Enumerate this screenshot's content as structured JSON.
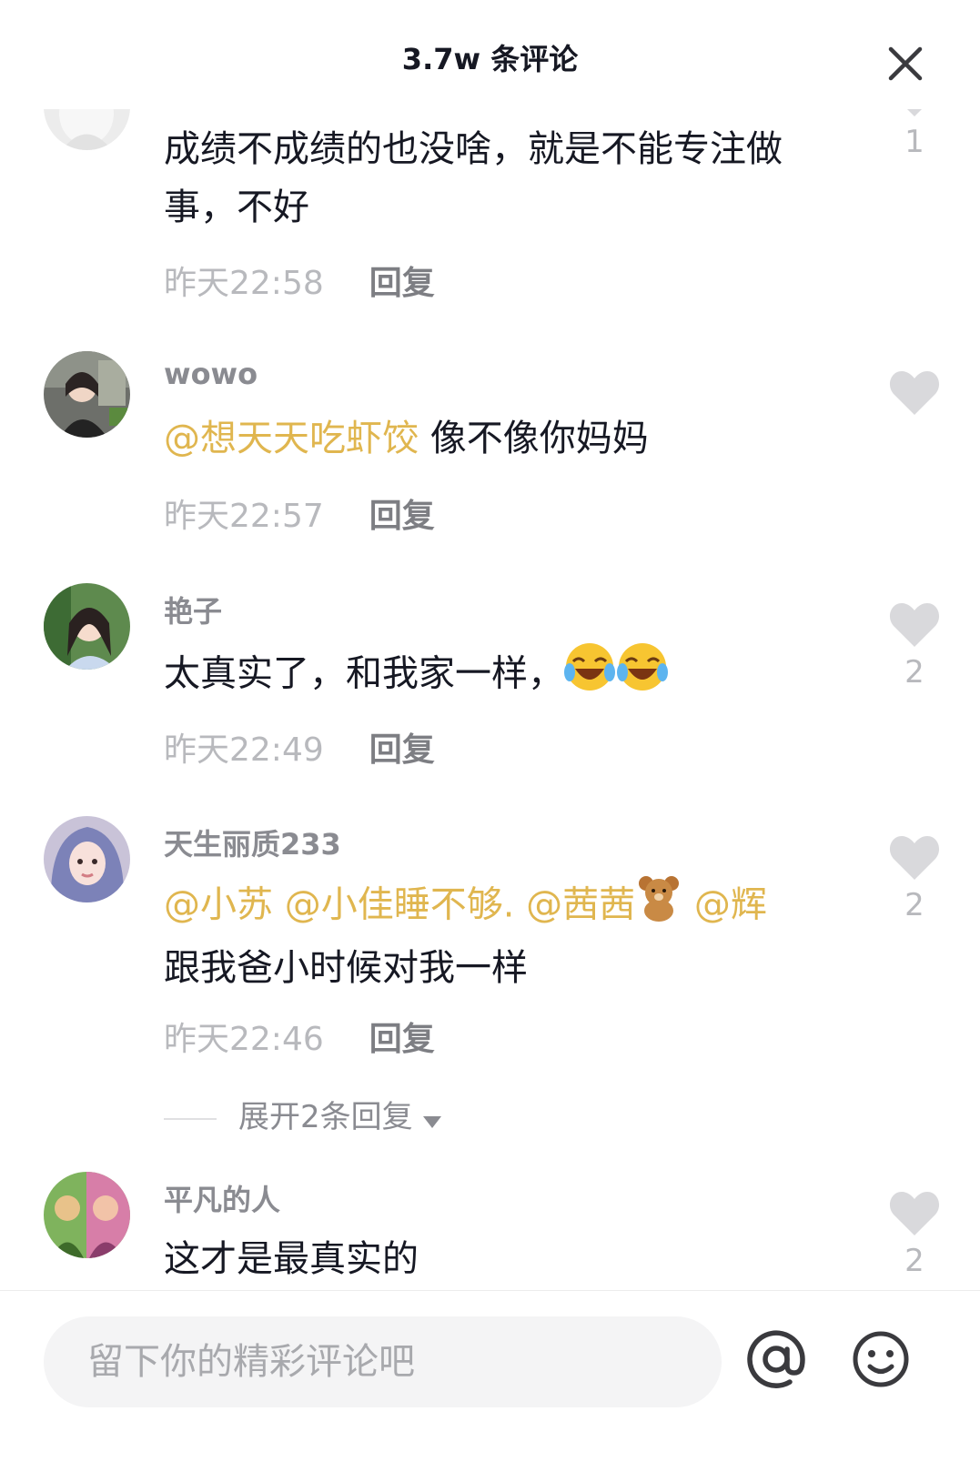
{
  "header": {
    "title": "3.7w 条评论"
  },
  "comments": [
    {
      "username": "",
      "text": "成绩不成绩的也没啥，就是不能专注做事，不好",
      "time": "昨天22:58",
      "reply": "回复",
      "likes": "1"
    },
    {
      "username": "wowo",
      "mention": "@想天天吃虾饺",
      "text": " 像不像你妈妈",
      "time": "昨天22:57",
      "reply": "回复",
      "likes": ""
    },
    {
      "username": "艳子",
      "text": "太真实了，和我家一样，",
      "emoji": "laughing-crying",
      "time": "昨天22:49",
      "reply": "回复",
      "likes": "2"
    },
    {
      "username": "天生丽质233",
      "mentions": [
        "@小苏",
        "@小佳睡不够.",
        "@茜茜",
        "@辉"
      ],
      "text": "跟我爸小时候对我一样",
      "time": "昨天22:46",
      "reply": "回复",
      "likes": "2",
      "expand": "展开2条回复"
    },
    {
      "username": "平凡的人",
      "text": "这才是最真实的",
      "likes": "2"
    }
  ],
  "footer": {
    "input_placeholder": "留下你的精彩评论吧",
    "at_icon": "at-icon",
    "emoji_icon": "emoji-icon"
  },
  "colors": {
    "mention": "#e0b64f",
    "meta": "#b8b9bd",
    "username": "#8a8b91",
    "text": "#161823"
  }
}
